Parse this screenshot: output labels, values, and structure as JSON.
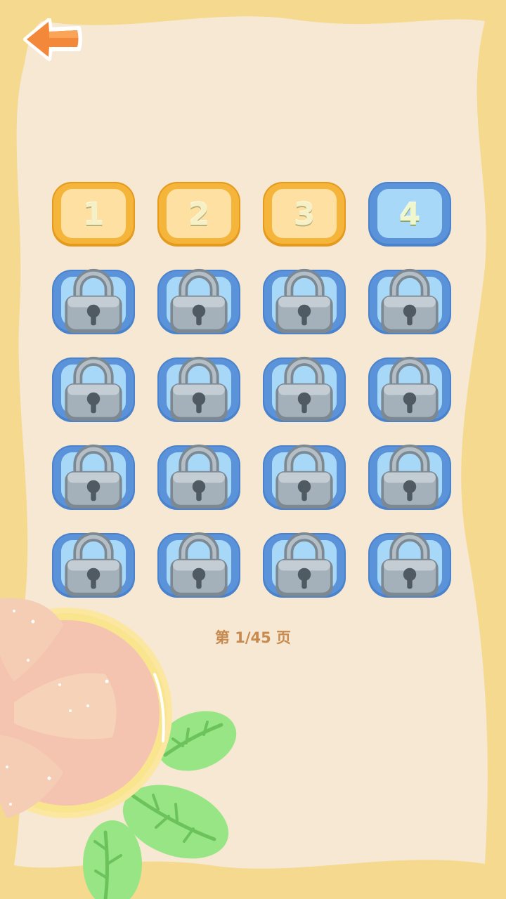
{
  "colors": {
    "background_border": "#f5d98f",
    "background_inner": "#f6e8d2",
    "tile_unlocked_fill": "#ffe0a3",
    "tile_unlocked_border": "#f5b43a",
    "tile_blue_fill": "#a8d8f8",
    "tile_blue_border": "#5a93d9",
    "lock_color": "#9aa8b2",
    "page_text": "#c88a4e",
    "back_arrow": "#f3883a"
  },
  "header": {
    "back_icon": "back-arrow-icon"
  },
  "levels": [
    {
      "label": "1",
      "state": "unlocked"
    },
    {
      "label": "2",
      "state": "unlocked"
    },
    {
      "label": "3",
      "state": "unlocked"
    },
    {
      "label": "4",
      "state": "current"
    },
    {
      "label": "",
      "state": "locked"
    },
    {
      "label": "",
      "state": "locked"
    },
    {
      "label": "",
      "state": "locked"
    },
    {
      "label": "",
      "state": "locked"
    },
    {
      "label": "",
      "state": "locked"
    },
    {
      "label": "",
      "state": "locked"
    },
    {
      "label": "",
      "state": "locked"
    },
    {
      "label": "",
      "state": "locked"
    },
    {
      "label": "",
      "state": "locked"
    },
    {
      "label": "",
      "state": "locked"
    },
    {
      "label": "",
      "state": "locked"
    },
    {
      "label": "",
      "state": "locked"
    },
    {
      "label": "",
      "state": "locked"
    },
    {
      "label": "",
      "state": "locked"
    },
    {
      "label": "",
      "state": "locked"
    },
    {
      "label": "",
      "state": "locked"
    }
  ],
  "pagination": {
    "text": "第 1/45 页"
  }
}
